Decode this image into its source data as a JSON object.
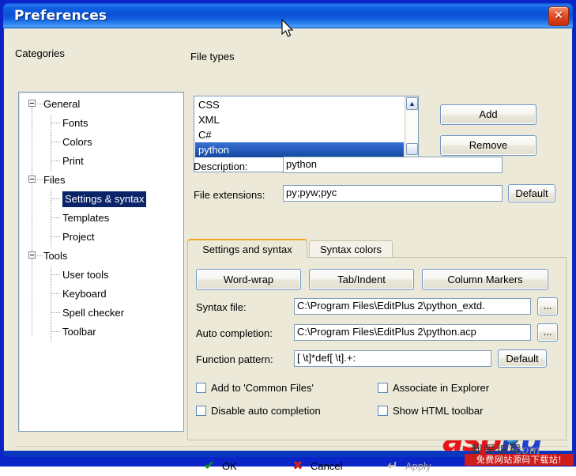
{
  "window": {
    "title": "Preferences",
    "close_label": "✕"
  },
  "categories": {
    "label": "Categories",
    "nodes": [
      {
        "label": "General",
        "level": 0,
        "expanded": true,
        "selected": false
      },
      {
        "label": "Fonts",
        "level": 1,
        "expanded": false,
        "selected": false
      },
      {
        "label": "Colors",
        "level": 1,
        "expanded": false,
        "selected": false
      },
      {
        "label": "Print",
        "level": 1,
        "expanded": false,
        "selected": false
      },
      {
        "label": "Files",
        "level": 0,
        "expanded": true,
        "selected": false
      },
      {
        "label": "Settings & syntax",
        "level": 1,
        "expanded": false,
        "selected": true
      },
      {
        "label": "Templates",
        "level": 1,
        "expanded": false,
        "selected": false
      },
      {
        "label": "Project",
        "level": 1,
        "expanded": false,
        "selected": false
      },
      {
        "label": "Tools",
        "level": 0,
        "expanded": true,
        "selected": false
      },
      {
        "label": "User tools",
        "level": 1,
        "expanded": false,
        "selected": false
      },
      {
        "label": "Keyboard",
        "level": 1,
        "expanded": false,
        "selected": false
      },
      {
        "label": "Spell checker",
        "level": 1,
        "expanded": false,
        "selected": false
      },
      {
        "label": "Toolbar",
        "level": 1,
        "expanded": false,
        "selected": false
      }
    ]
  },
  "file_types": {
    "label": "File types",
    "items": [
      {
        "label": "CSS",
        "selected": false
      },
      {
        "label": "XML",
        "selected": false
      },
      {
        "label": "C#",
        "selected": false
      },
      {
        "label": "python",
        "selected": true
      }
    ],
    "add_label": "Add",
    "remove_label": "Remove",
    "scroll_up_glyph": "▲",
    "scroll_down_glyph": "▼"
  },
  "fields": {
    "description_label": "Description:",
    "description_value": "python",
    "extensions_label": "File extensions:",
    "extensions_value": "py;pyw;pyc",
    "extensions_default_label": "Default"
  },
  "tabs": [
    {
      "label": "Settings and syntax",
      "active": true
    },
    {
      "label": "Syntax colors",
      "active": false
    }
  ],
  "settings_panel": {
    "buttons": [
      {
        "label": "Word-wrap"
      },
      {
        "label": "Tab/Indent"
      },
      {
        "label": "Column Markers"
      }
    ],
    "syntax_file_label": "Syntax file:",
    "syntax_file_value": "C:\\Program Files\\EditPlus 2\\python_extd.",
    "auto_completion_label": "Auto completion:",
    "auto_completion_value": "C:\\Program Files\\EditPlus 2\\python.acp",
    "function_pattern_label": "Function pattern:",
    "function_pattern_value": "[ \\t]*def[ \\t].+:",
    "function_pattern_default_label": "Default",
    "browse_label": "...",
    "checkboxes": [
      {
        "label": "Add to 'Common Files'",
        "checked": false
      },
      {
        "label": "Associate in Explorer",
        "checked": false
      },
      {
        "label": "Disable auto completion",
        "checked": false
      },
      {
        "label": "Show HTML toolbar",
        "checked": false
      }
    ]
  },
  "footer": {
    "ok_label": "OK",
    "ok_icon": "✔",
    "cancel_label": "Cancel",
    "cancel_icon": "✖",
    "apply_label": "Apply",
    "apply_icon": "↵",
    "apply_disabled": true
  },
  "watermark": {
    "asp": "asp",
    "ku": "ku",
    "domain": "com",
    "cn_top": "我爱编程",
    "cn_bar": "免费网站源码下载站!"
  },
  "colors": {
    "title_blue": "#0a50d8",
    "selection_blue": "#2156c4",
    "tree_selection": "#0a246a",
    "face": "#ece9d8",
    "tab_accent": "#f0a31c",
    "ok_green": "#0f9b12",
    "cancel_red": "#c81f1f",
    "close_red": "#e8502a"
  }
}
